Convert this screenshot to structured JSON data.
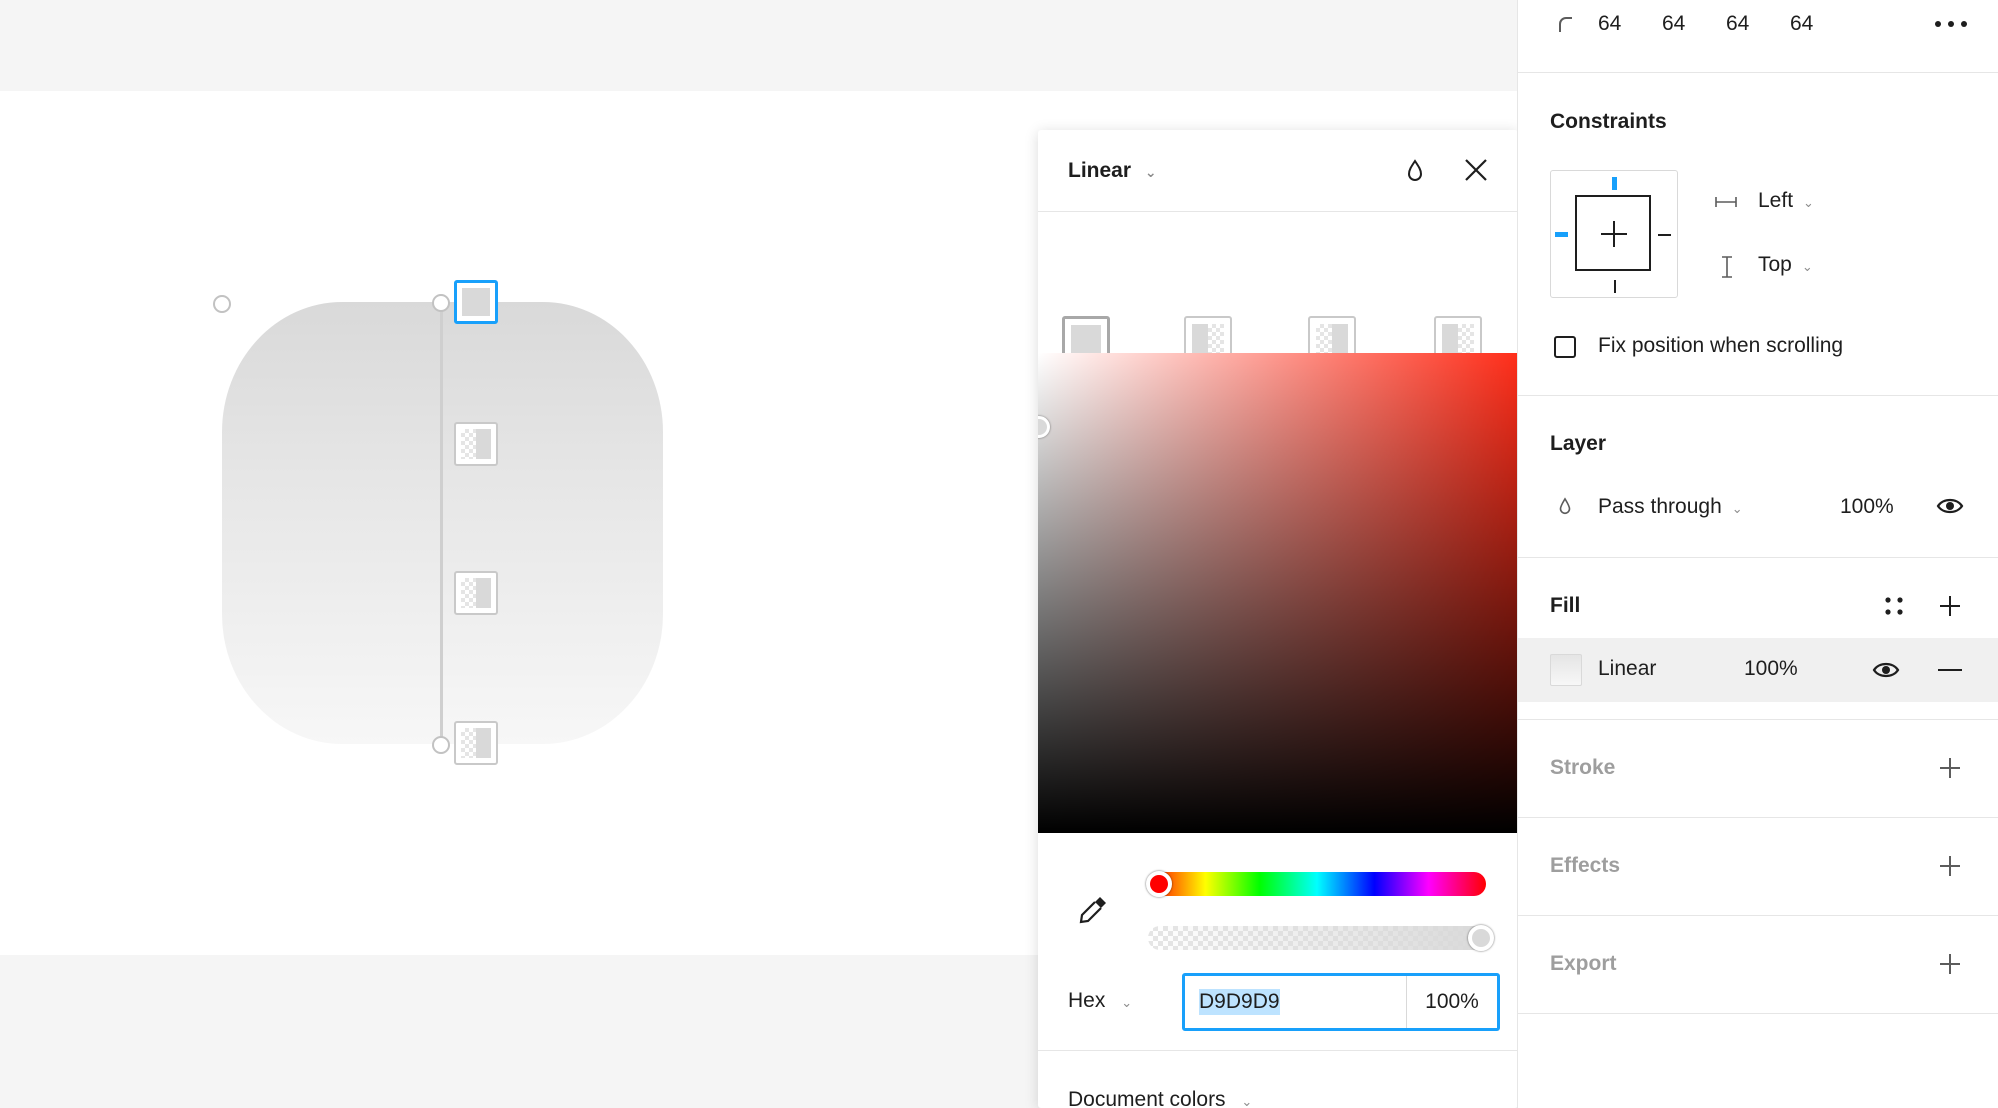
{
  "corner_radius": {
    "values": [
      "64",
      "64",
      "64",
      "64"
    ]
  },
  "constraints": {
    "title": "Constraints",
    "horizontal": "Left",
    "vertical": "Top",
    "fix_position_label": "Fix position when scrolling"
  },
  "layer": {
    "title": "Layer",
    "blend_mode": "Pass through",
    "opacity": "100%"
  },
  "fill": {
    "title": "Fill",
    "type": "Linear",
    "opacity": "100%"
  },
  "stroke": {
    "title": "Stroke"
  },
  "effects": {
    "title": "Effects"
  },
  "export": {
    "title": "Export"
  },
  "picker": {
    "mode": "Linear",
    "color_model": "Hex",
    "hex_value": "D9D9D9",
    "alpha": "100%",
    "document_colors_label": "Document colors"
  },
  "colors": {
    "accent": "#18a0fb",
    "fill_color": "#D9D9D9"
  }
}
